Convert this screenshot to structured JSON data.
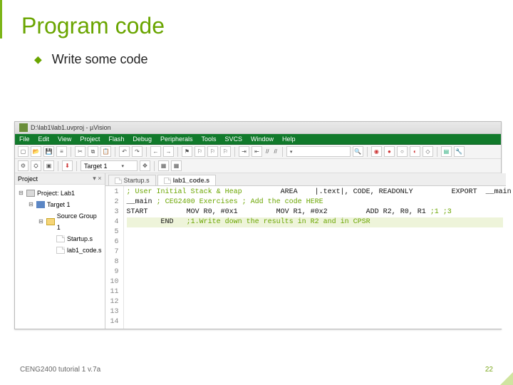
{
  "slide": {
    "title": "Program code",
    "bullet": "Write some code"
  },
  "window": {
    "titlebar": "D:\\lab1\\lab1.uvproj - µVision",
    "menu": [
      "File",
      "Edit",
      "View",
      "Project",
      "Flash",
      "Debug",
      "Peripherals",
      "Tools",
      "SVCS",
      "Window",
      "Help"
    ],
    "target_selector": "Target 1",
    "panel_title": "Project",
    "tree": {
      "root": "Project: Lab1",
      "target": "Target 1",
      "group": "Source Group 1",
      "files": [
        "Startup.s",
        "lab1_code.s"
      ]
    },
    "tabs": [
      "Startup.s",
      "lab1_code.s"
    ],
    "code": [
      "; User Initial Stack & Heap",
      "        AREA    |.text|, CODE, READONLY",
      "        EXPORT  __main",
      "__main",
      "; CEG2400 Exercises",
      "; Add the code HERE",
      "START",
      "        MOV R0, #0x1",
      "        MOV R1, #0x2",
      "        ADD R2, R0, R1",
      ";1",
      ";3",
      "        END   ;1.Write down the results in R2 and in CPSR",
      ""
    ]
  },
  "footer": {
    "left": "CENG2400 tutorial 1 v.7a",
    "right": "22"
  }
}
